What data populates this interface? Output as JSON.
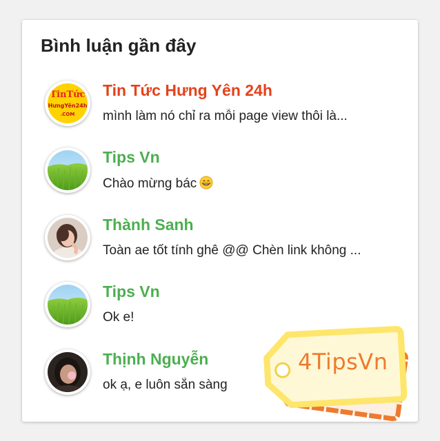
{
  "widget": {
    "title": "Bình luận gần đây"
  },
  "comments": [
    {
      "author": "Tin Tức Hưng Yên 24h",
      "author_color": "#e4421b",
      "excerpt": "mình làm nó chỉ ra mỗi page view thôi là...",
      "avatar": "news-logo",
      "avatar_text": [
        "TinTức",
        "HưngYên24h",
        ".COM"
      ]
    },
    {
      "author": "Tips Vn",
      "author_color": "#4caf50",
      "excerpt": "Chào mừng bác",
      "emoji": "grinning-emoji",
      "avatar": "grass-field"
    },
    {
      "author": "Thành Sanh",
      "author_color": "#4caf50",
      "excerpt": "Toàn ae tốt tính ghê @@ Chèn link không ...",
      "avatar": "portrait-girl"
    },
    {
      "author": "Tips Vn",
      "author_color": "#4caf50",
      "excerpt": "Ok e!",
      "avatar": "grass-field"
    },
    {
      "author": "Thịnh Nguyễn",
      "author_color": "#4caf50",
      "excerpt": "ok ạ, e luôn sẵn sàng",
      "avatar": "portrait-dark"
    }
  ],
  "watermark": {
    "text": "4TipsVn",
    "colors": {
      "tag_front": "#fde66b",
      "tag_back": "#ee7a2f",
      "text": "#ee7a2f"
    }
  }
}
